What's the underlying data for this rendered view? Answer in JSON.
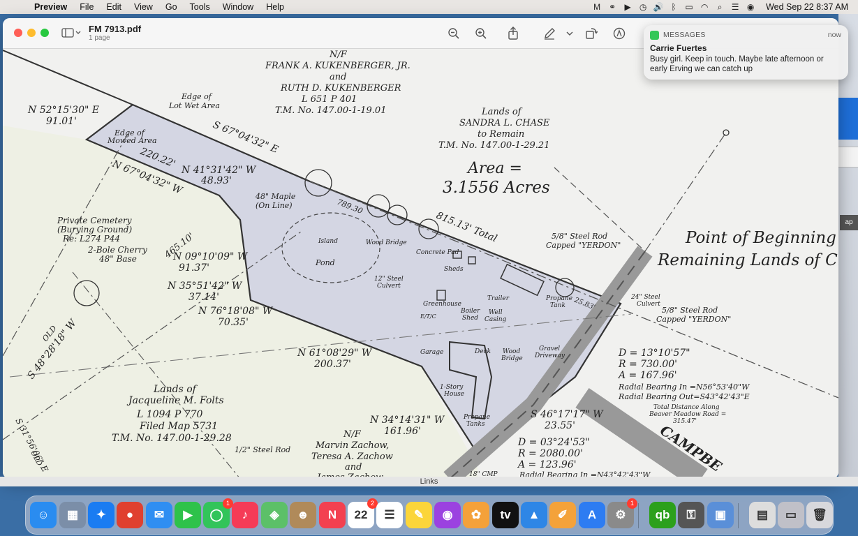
{
  "menubar": {
    "app_name": "Preview",
    "items": [
      "File",
      "Edit",
      "View",
      "Go",
      "Tools",
      "Window",
      "Help"
    ],
    "clock": "Wed Sep 22  8:37 AM"
  },
  "window": {
    "title": "FM 7913.pdf",
    "subtitle": "1 page",
    "links_label": "Links"
  },
  "notification": {
    "app": "MESSAGES",
    "time": "now",
    "sender": "Carrie Fuertes",
    "body": "Busy girl. Keep in touch. Maybe late afternoon or early Erving we can catch up"
  },
  "map": {
    "labels": {
      "nf_top": "N/F",
      "owner1": "FRANK A. KUKENBERGER, JR.",
      "and1": "and",
      "owner2": "RUTH D. KUKENBERGER",
      "liber1": "L 651   P 401",
      "tm1": "T.M. No. 147.00-1-19.01",
      "edge_lot": "Edge of",
      "edge_lot2": "Lot Wet Area",
      "bearing1": "N 52°15'30\" E",
      "dist1": "91.01'",
      "edge_mowed": "Edge of",
      "edge_mowed2": "Mowed Area",
      "bearing2": "S 67°04'32\" E",
      "lands_chase1": "Lands of",
      "lands_chase2": "SANDRA L. CHASE",
      "lands_chase3": "to Remain",
      "lands_chase4": "T.M. No. 147.00-1-29.21",
      "area1": "Area =",
      "area2": "3.1556 Acres",
      "dist2": "220.22'",
      "bearing3": "N 41°31'42\" W",
      "dist3": "48.93'",
      "bearing4": "N 67°04'32\" W",
      "maple1": "48\" Maple",
      "maple2": "(On Line)",
      "dist_789": "789.30",
      "total": "815.13' Total",
      "steel_rod1": "5/8\" Steel Rod",
      "steel_rod1b": "Capped \"YERDON\"",
      "pob1": "Point of Beginning",
      "pob2": "Remaining Lands of Cha",
      "cemetery1": "Private Cemetery",
      "cemetery2": "(Burying Ground)",
      "cemetery3": "Re: L274 P44",
      "cherry1": "2-Bole Cherry",
      "cherry2": "48\" Base",
      "line_dist": "465.10'",
      "bearing5": "N 09°10'09\" W",
      "dist5": "91.37'",
      "island": "Island",
      "wood_bridge": "Wood Bridge",
      "pond": "Pond",
      "concrete_pad": "Concrete Pad",
      "sheds": "Sheds",
      "bearing6": "N 35°51'42\" W",
      "dist6": "37.14'",
      "culvert12": "12\" Steel",
      "culvert12b": "Culvert",
      "greenhouse": "Greenhouse",
      "trailer": "Trailer",
      "propane": "Propane",
      "propane_b": "Tank",
      "d2583": "25.83'",
      "culvert24": "24\" Steel",
      "culvert24b": "Culvert",
      "steel_rod2": "5/8\" Steel Rod",
      "steel_rod2b": "Capped \"YERDON\"",
      "bearing7": "N 76°18'08\" W",
      "dist7": "70.35'",
      "boiler": "Boiler",
      "boiler_b": "Shed",
      "well": "Well",
      "well_b": "Casing",
      "etc": "E/T/C",
      "old_bearing": "S 48°28'18\" W",
      "old": "OLD",
      "garage": "Garage",
      "deck": "Deck",
      "wood_bridge2": "Wood",
      "wood_bridge2b": "Bridge",
      "gravel": "Gravel",
      "gravel_b": "Driveway",
      "curve1_d": "D = 13°10'57\"",
      "curve1_r": "R = 730.00'",
      "curve1_a": "A = 167.96'",
      "curve1_in": "Radial Bearing In =N56°53'40\"W",
      "curve1_out": "Radial Bearing Out=S43°42'43\"E",
      "bearing8": "N 61°08'29\" W",
      "dist8": "200.37'",
      "house": "1-Story",
      "house_b": "House",
      "total_dist1": "Total Distance Along",
      "total_dist2": "Beaver Meadow Road =",
      "total_dist3": "315.47'",
      "folts1": "Lands of",
      "folts2": "Jacqueline M. Folts",
      "folts3": "L 1094   P 770",
      "folts4": "Filed Map 5731",
      "folts5": "T.M. No. 147.00-1-29.28",
      "bearing9": "N 34°14'31\" W",
      "dist9": "161.96'",
      "bearing10": "S 46°17'17\" W",
      "dist10": "23.55'",
      "propane_tanks": "Propane",
      "propane_tanks_b": "Tanks",
      "curve2_d": "D = 03°24'53\"",
      "curve2_r": "R = 2080.00'",
      "curve2_a": "A = 123.96'",
      "curve2_in": "Radial Bearing In =N43°42'43\"W",
      "bearing11": "S 31°56'06\" E",
      "old2": "OLD",
      "steel_rod3": "1/2\" Steel Rod",
      "nf_bottom": "N/F",
      "zachow1": "Marvin Zachow,",
      "zachow2": "Teresa A. Zachow",
      "zachow3": "and",
      "zachow4": "James Zachow",
      "cmp": "18\" CMP",
      "road": "CAMPBE"
    }
  },
  "dock": {
    "items": [
      {
        "name": "Finder",
        "color": "#2a8cf0",
        "glyph": "☺"
      },
      {
        "name": "Launchpad",
        "color": "#7b8ea8",
        "glyph": "▦"
      },
      {
        "name": "Safari",
        "color": "#1a7cf2",
        "glyph": "✦"
      },
      {
        "name": "Chrome",
        "color": "#e0402f",
        "glyph": "●"
      },
      {
        "name": "Mail",
        "color": "#2f8ef2",
        "glyph": "✉"
      },
      {
        "name": "FaceTime",
        "color": "#2ec24a",
        "glyph": "▶"
      },
      {
        "name": "Messages",
        "color": "#32c45a",
        "glyph": "◯",
        "badge": "1"
      },
      {
        "name": "Music",
        "color": "#f53b57",
        "glyph": "♪"
      },
      {
        "name": "Maps",
        "color": "#5cc068",
        "glyph": "◈"
      },
      {
        "name": "Contacts",
        "color": "#b08a5a",
        "glyph": "☻"
      },
      {
        "name": "News",
        "color": "#f34050",
        "glyph": "N"
      },
      {
        "name": "Calendar",
        "color": "#ffffff",
        "glyph": "22",
        "badge": "2",
        "dark": true
      },
      {
        "name": "Reminders",
        "color": "#ffffff",
        "glyph": "☰",
        "dark": true
      },
      {
        "name": "Notes",
        "color": "#fbd53a",
        "glyph": "✎"
      },
      {
        "name": "Podcasts",
        "color": "#9b42e0",
        "glyph": "◉"
      },
      {
        "name": "Photos",
        "color": "#f4a13a",
        "glyph": "✿"
      },
      {
        "name": "TV",
        "color": "#111111",
        "glyph": "tv"
      },
      {
        "name": "Keynote",
        "color": "#2e86e6",
        "glyph": "▲"
      },
      {
        "name": "Pages",
        "color": "#f4a23a",
        "glyph": "✐"
      },
      {
        "name": "App Store",
        "color": "#2d7cf2",
        "glyph": "A"
      },
      {
        "name": "System Preferences",
        "color": "#8a8a8a",
        "glyph": "⚙",
        "badge": "1"
      },
      {
        "name": "QuickBooks",
        "color": "#2ca01c",
        "glyph": "qb"
      },
      {
        "name": "Keychain",
        "color": "#555555",
        "glyph": "⚿"
      },
      {
        "name": "Preview",
        "color": "#5a8fd8",
        "glyph": "▣"
      },
      {
        "name": "Documents",
        "color": "#dddddd",
        "glyph": "▤",
        "dark": true
      },
      {
        "name": "Downloads",
        "color": "#c0c0c8",
        "glyph": "▭",
        "dark": true
      },
      {
        "name": "Trash",
        "color": "#d8d8dc",
        "glyph": "🗑",
        "dark": true
      }
    ]
  }
}
